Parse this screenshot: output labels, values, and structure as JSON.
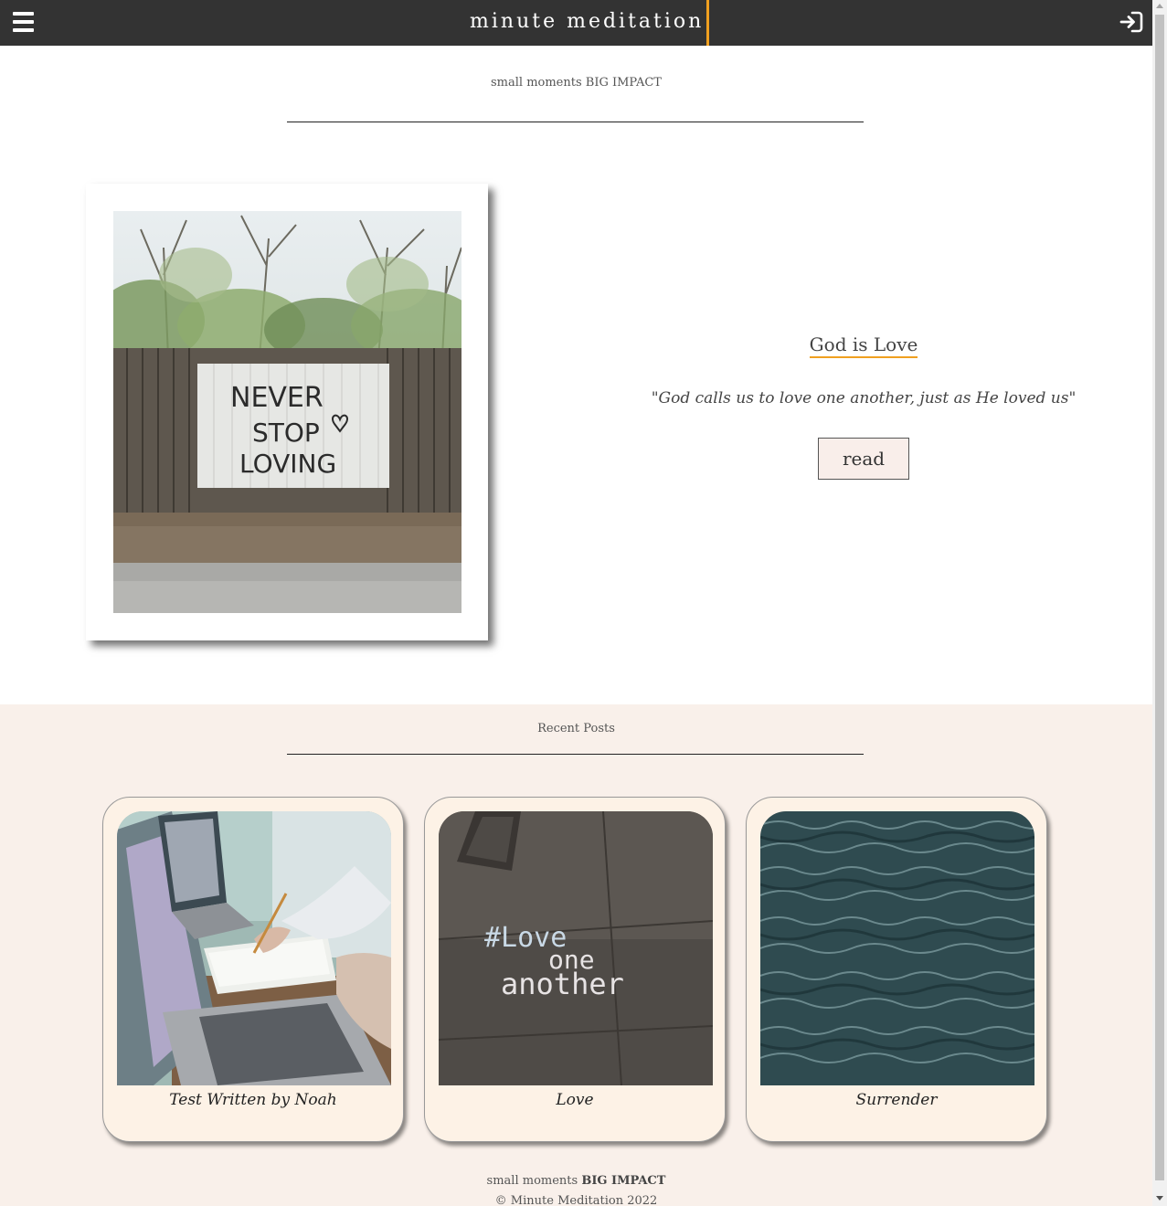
{
  "nav": {
    "brand": "minute meditation",
    "menu_icon": "hamburger-menu-icon",
    "login_icon": "sign-in-icon"
  },
  "hero": {
    "tagline": "small moments BIG IMPACT"
  },
  "featured": {
    "image_text": [
      "NEVER",
      "STOP",
      "LOVING"
    ],
    "title": "God is Love",
    "quote": "\"God calls us to love one another, just as He loved us\"",
    "read_label": "read"
  },
  "recent": {
    "heading": "Recent Posts",
    "posts": [
      {
        "title": "Test Written by Noah"
      },
      {
        "title": "Love",
        "image_text": [
          "#Love",
          "one",
          "another"
        ]
      },
      {
        "title": "Surrender"
      }
    ]
  },
  "footer": {
    "tagline_small": "small moments",
    "tagline_bold": "BIG IMPACT",
    "copyright": "© Minute Meditation 2022"
  },
  "colors": {
    "nav_bg": "#333333",
    "accent": "#f0a020",
    "section_bg": "#f9f0ea",
    "card_bg": "#fdf2e6",
    "button_bg": "#f9eeea"
  }
}
